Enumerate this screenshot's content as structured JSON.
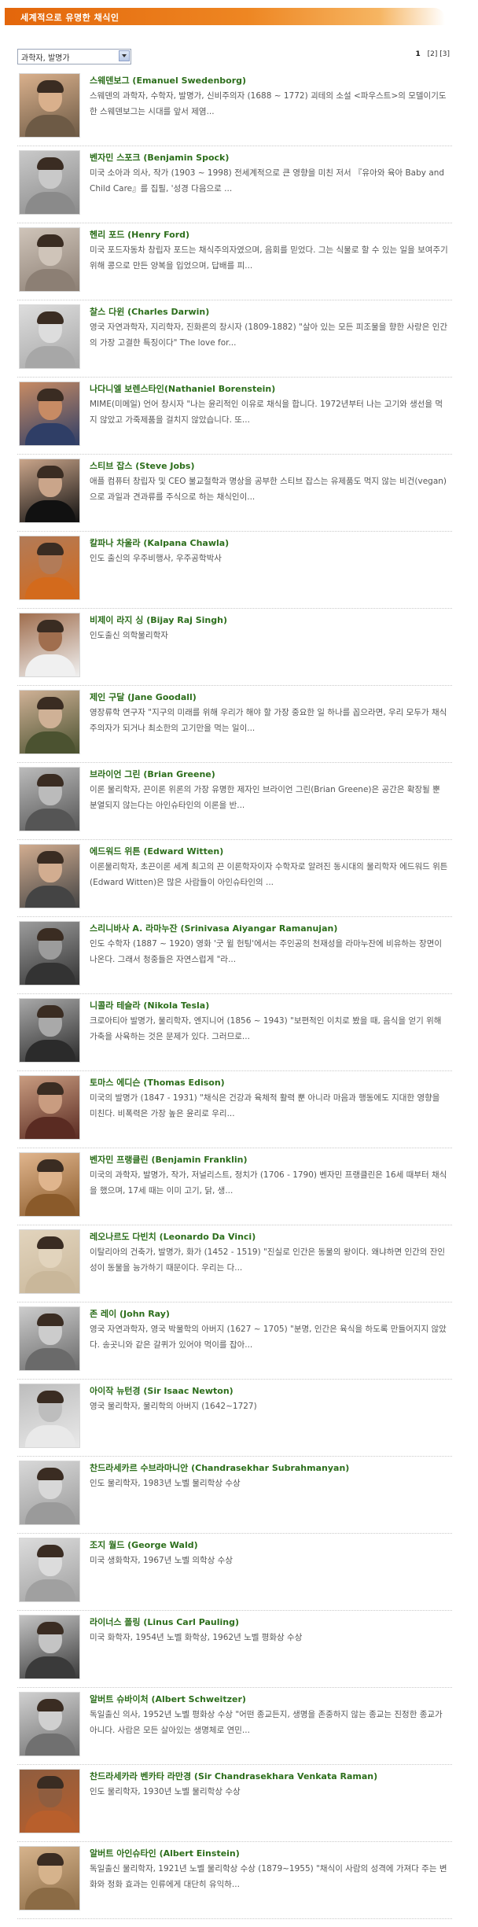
{
  "header": {
    "title": "세계적으로 유명한 채식인"
  },
  "filter": {
    "selected": "과학자, 발명가"
  },
  "pager": {
    "current": "1",
    "pages": [
      "[2]",
      "[3]"
    ]
  },
  "people": [
    {
      "name": "스웨덴보그 (Emanuel Swedenborg)",
      "desc": "스웨덴의 과학자, 수학자, 발명가, 신비주의자 (1688 ~ 1772) 괴테의 소설 <파우스트>의 모델이기도 한 스웨덴보그는 시대를 앞서 제염...",
      "tone": "#6d5a45",
      "face": "#d9b08c"
    },
    {
      "name": "벤자민 스포크 (Benjamin Spock)",
      "desc": "미국 소아과 의사, 작가 (1903 ~ 1998) 전세계적으로 큰 영향을 미친 저서 『유아와 육아 Baby and Child Care』를 집필, '성경 다음으로 ...",
      "tone": "#8a8a8a",
      "face": "#c9c9c9"
    },
    {
      "name": "헨리 포드 (Henry Ford)",
      "desc": "미국 포드자동차 창립자 포드는 채식주의자였으며, 음회를 믿었다. 그는 식물로 할 수 있는 일을 보여주기 위해 콩으로 만든 양복을 입었으며, 답배를 피...",
      "tone": "#8c7f74",
      "face": "#cfc4b9"
    },
    {
      "name": "찰스 다윈 (Charles Darwin)",
      "desc": "영국 자연과학자, 지리학자, 진화론의 창시자 (1809-1882) \"살아 있는 모든 피조물을 향한 사랑은 인간의 가장 고결한 특징이다\" The love for...",
      "tone": "#a7a7a7",
      "face": "#dddddd"
    },
    {
      "name": "나다니엘 보렌스타인(Nathaniel Borenstein)",
      "desc": "MIME(미메일) 언어 창시자 \"나는 윤리적인 이유로 채식을 합니다. 1972년부터 나는 고기와 생선을 먹지 않았고 가죽제품을 걸치지 않았습니다. 또...",
      "tone": "#2f3e66",
      "face": "#c78b64"
    },
    {
      "name": "스티브 잡스 (Steve Jobs)",
      "desc": "애플 컴퓨터 창립자 및 CEO 불교철학과 명상을 공부한 스티브 잡스는 유제품도 먹지 않는 비건(vegan)으로 과일과 견과류를 주식으로 하는 채식인이...",
      "tone": "#111111",
      "face": "#caa58a"
    },
    {
      "name": "칼파나 차울라 (Kalpana Chawla)",
      "desc": "인도 출신의 우주비행사, 우주공학박사",
      "tone": "#d36a1c",
      "face": "#b27b58"
    },
    {
      "name": "비제이 라지 싱 (Bijay Raj Singh)",
      "desc": "인도출신 의학물리학자",
      "tone": "#f0f0f0",
      "face": "#a06e4e"
    },
    {
      "name": "제인 구달 (Jane Goodall)",
      "desc": "영장류학 연구자 \"지구의 미래를 위해 우리가 해야 할 가장 중요한 일 하나를 꼽으라면, 우리 모두가 채식주의자가 되거나 최소한의 고기만을 먹는 일이...",
      "tone": "#4b5230",
      "face": "#cfb196"
    },
    {
      "name": "브라이언 그린 (Brian Greene)",
      "desc": "이론 물리학자, 끈이론 위론의 가장 유명한 제자인 브라이언 그린(Brian Greene)은 공간은 확장될 뿐 분열되지 않는다는 아인슈타인의 이론을 반...",
      "tone": "#555555",
      "face": "#bbbbbb"
    },
    {
      "name": "에드워드 위튼 (Edward Witten)",
      "desc": "이론물리학자, 초끈이론 세계 최고의 끈 이론학자이자 수학자로 알려진 동시대의 물리학자 에드워드 위튼(Edward Witten)은 많은 사람들이 아인슈타인의 ...",
      "tone": "#444444",
      "face": "#d2ad90"
    },
    {
      "name": "스리니바사 A. 라마누잔 (Srinivasa Aiyangar Ramanujan)",
      "desc": "인도 수학자 (1887 ~ 1920) 영화 '굿 윌 헌팅'에서는 주인공의 천재성을 라마누잔에 비유하는 장면이 나온다. 그래서 청중들은 자연스럽게 \"라...",
      "tone": "#333333",
      "face": "#9c9c9c"
    },
    {
      "name": "니콜라 테슬라 (Nikola Tesla)",
      "desc": "크로아티아 발명가, 물리학자, 엔지니어 (1856 ~ 1943) \"보편적인 이치로 봤을 때, 음식을 얻기 위해 가축을 사육하는 것은 문제가 있다. 그러므로...",
      "tone": "#2b2b2b",
      "face": "#a9a9a9"
    },
    {
      "name": "토마스 에디슨 (Thomas Edison)",
      "desc": "미국의 발명가 (1847 - 1931) \"채식은 건강과 육체적 활력 뿐 아니라 마음과 행동에도 지대한 영향을 미친다. 비폭력은 가장 높은 윤리로 우리...",
      "tone": "#5a2b22",
      "face": "#c99c80"
    },
    {
      "name": "벤자민 프랭클린 (Benjamin Franklin)",
      "desc": "미국의 과학자, 발명가, 작가, 저널리스트, 정치가 (1706 - 1790) 벤자민 프랭클린은 16세 때부터 채식을 했으며, 17세 때는 이미 고기, 닭, 생...",
      "tone": "#8a5a2a",
      "face": "#e0b58d"
    },
    {
      "name": "레오나르도 다빈치 (Leonardo Da Vinci)",
      "desc": "이탈리아의 건축가, 발명가, 화가 (1452 - 1519) \"진실로 인간은 동물의 왕이다. 왜냐하면 인간의 잔인성이 동물을 능가하기 때문이다. 우리는 다...",
      "tone": "#c9b79a",
      "face": "#e2d4bd"
    },
    {
      "name": "존 레이 (John Ray)",
      "desc": "영국 자연과학자, 영국 박물학의 아버지 (1627 ~ 1705) \"분명, 인간은 육식을 하도록 만들어지지 않았다. 송곳니와 같은 갈퀴가 있어야 먹이를 잡아...",
      "tone": "#6a6a6a",
      "face": "#cccccc"
    },
    {
      "name": "아이작 뉴턴경 (Sir Isaac Newton)",
      "desc": "영국 물리학자, 물리학의 아버지 (1642~1727)",
      "tone": "#e9e9e9",
      "face": "#bdbdbd"
    },
    {
      "name": "찬드라세카르 수브라마니안 (Chandrasekhar Subrahmanyan)",
      "desc": "인도 물리학자, 1983년 노벨 물리학상 수상",
      "tone": "#9a9a9a",
      "face": "#d8d8d8"
    },
    {
      "name": "조지 월드 (George Wald)",
      "desc": "미국 생화학자, 1967년 노벨 의학상 수상",
      "tone": "#a0a0a0",
      "face": "#dcdcdc"
    },
    {
      "name": "라이너스 폴링 (Linus Carl Pauling)",
      "desc": "미국 화학자, 1954년 노벨 화학상, 1962년 노벨 평화상 수상",
      "tone": "#3a3a3a",
      "face": "#c4c4c4"
    },
    {
      "name": "알버트 슈바이처 (Albert Schweitzer)",
      "desc": "독일출신 의사, 1952년 노벨 평화상 수상 \"어떤 종교든지, 생명을 존중하지 않는 종교는 진정한 종교가 아니다. 사람은 모든 살아있는 생명체로 연민...",
      "tone": "#707070",
      "face": "#d0d0d0"
    },
    {
      "name": "찬드라세카라 벤카타 라만경 (Sir Chandrasekhara Venkata Raman)",
      "desc": "인도 물리학자, 1930년 노벨 물리학상 수상",
      "tone": "#b85f2c",
      "face": "#8f5d3f"
    },
    {
      "name": "알버트 아인슈타인 (Albert Einstein)",
      "desc": "독일출신 물리학자, 1921년 노벨 물리학상 수상 (1879~1955) \"채식이 사람의 성격에 가져다 주는 변화와 정화 효과는 인류에게 대단히 유익하...",
      "tone": "#8b6b45",
      "face": "#d6b38c"
    }
  ]
}
